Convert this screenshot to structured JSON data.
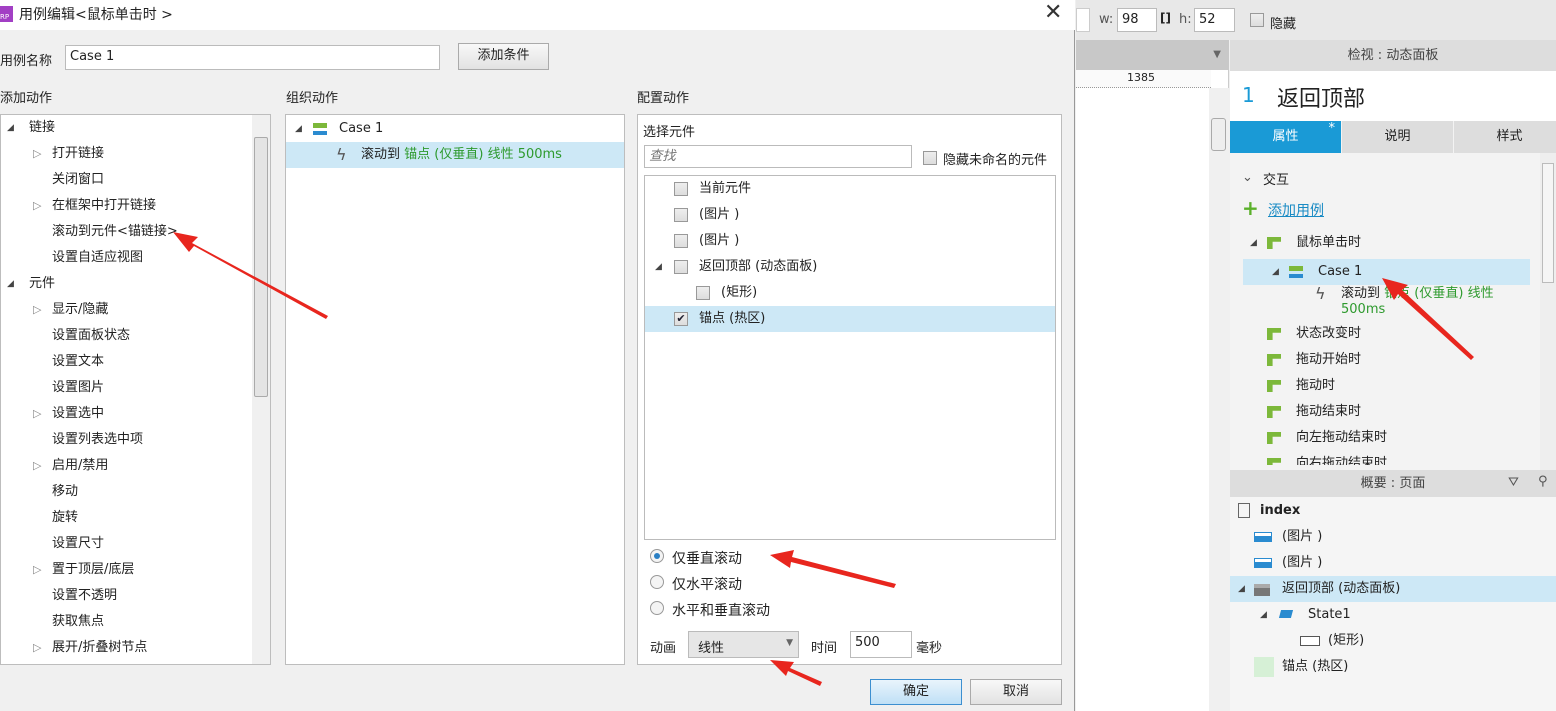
{
  "dialog": {
    "title": "用例编辑<鼠标单击时 >",
    "case_name_label": "用例名称",
    "case_name_value": "Case 1",
    "add_condition": "添加条件",
    "add_action_header": "添加动作",
    "organize_header": "组织动作",
    "configure_header": "配置动作",
    "actions": [
      {
        "label": "链接",
        "level": 0,
        "state": "expanded"
      },
      {
        "label": "打开链接",
        "level": 1,
        "state": "collapsed"
      },
      {
        "label": "关闭窗口",
        "level": 1,
        "state": "none"
      },
      {
        "label": "在框架中打开链接",
        "level": 1,
        "state": "collapsed"
      },
      {
        "label": "滚动到元件<锚链接>",
        "level": 1,
        "state": "none"
      },
      {
        "label": "设置自适应视图",
        "level": 1,
        "state": "none"
      },
      {
        "label": "元件",
        "level": 0,
        "state": "expanded"
      },
      {
        "label": "显示/隐藏",
        "level": 1,
        "state": "collapsed"
      },
      {
        "label": "设置面板状态",
        "level": 1,
        "state": "none"
      },
      {
        "label": "设置文本",
        "level": 1,
        "state": "none"
      },
      {
        "label": "设置图片",
        "level": 1,
        "state": "none"
      },
      {
        "label": "设置选中",
        "level": 1,
        "state": "collapsed"
      },
      {
        "label": "设置列表选中项",
        "level": 1,
        "state": "none"
      },
      {
        "label": "启用/禁用",
        "level": 1,
        "state": "collapsed"
      },
      {
        "label": "移动",
        "level": 1,
        "state": "none"
      },
      {
        "label": "旋转",
        "level": 1,
        "state": "none"
      },
      {
        "label": "设置尺寸",
        "level": 1,
        "state": "none"
      },
      {
        "label": "置于顶层/底层",
        "level": 1,
        "state": "collapsed"
      },
      {
        "label": "设置不透明",
        "level": 1,
        "state": "none"
      },
      {
        "label": "获取焦点",
        "level": 1,
        "state": "none"
      },
      {
        "label": "展开/折叠树节点",
        "level": 1,
        "state": "collapsed"
      }
    ],
    "organize": {
      "case": "Case 1",
      "action_prefix": "滚动到",
      "action_detail": "锚点 (仅垂直) 线性 500ms"
    },
    "configure": {
      "select_widget": "选择元件",
      "search_placeholder": "查找",
      "hide_unnamed": "隐藏未命名的元件",
      "widgets": [
        {
          "label": "当前元件",
          "checked": false,
          "level": 0
        },
        {
          "label": "(图片 )",
          "checked": false,
          "level": 0
        },
        {
          "label": "(图片 )",
          "checked": false,
          "level": 0
        },
        {
          "label": "返回顶部 (动态面板)",
          "checked": false,
          "level": 0,
          "expanded": true
        },
        {
          "label": "(矩形)",
          "checked": false,
          "level": 1
        },
        {
          "label": "锚点 (热区)",
          "checked": true,
          "level": 0,
          "selected": true
        }
      ],
      "scroll_options": [
        {
          "label": "仅垂直滚动",
          "selected": true
        },
        {
          "label": "仅水平滚动",
          "selected": false
        },
        {
          "label": "水平和垂直滚动",
          "selected": false
        }
      ],
      "animate_label": "动画",
      "animate_value": "线性",
      "time_label": "时间",
      "time_value": "500",
      "ms_label": "毫秒"
    },
    "ok": "确定",
    "cancel": "取消"
  },
  "toolbar": {
    "w_label": "w:",
    "w_value": "98",
    "h_label": "h:",
    "h_value": "52",
    "hidden_label": "隐藏"
  },
  "ruler": {
    "mark": "1385"
  },
  "inspector": {
    "title": "检视 : 动态面板",
    "number": "1",
    "name": "返回顶部",
    "tabs": [
      "属性",
      "说明",
      "样式"
    ],
    "tab_mark": "*",
    "interaction": "交互",
    "add_case": "添加用例",
    "event": "鼠标单击时",
    "case": "Case 1",
    "action_prefix": "滚动到",
    "action_detail": "锚点 (仅垂直) 线性",
    "action_time": "500ms",
    "events": [
      "状态改变时",
      "拖动开始时",
      "拖动时",
      "拖动结束时",
      "向左拖动结束时",
      "向右拖动结束时"
    ]
  },
  "outline": {
    "title": "概要 : 页面",
    "page": "index",
    "items": [
      {
        "label": "(图片 )",
        "icon": "image-icon",
        "level": 0
      },
      {
        "label": "(图片 )",
        "icon": "image-icon",
        "level": 0
      },
      {
        "label": "返回顶部 (动态面板)",
        "icon": "dynamic-panel-icon",
        "level": 0,
        "selected": true
      },
      {
        "label": "State1",
        "icon": "state-icon",
        "level": 1
      },
      {
        "label": "(矩形)",
        "icon": "rectangle-icon",
        "level": 2
      },
      {
        "label": "锚点 (热区)",
        "icon": "hotspot-icon",
        "level": 0
      }
    ]
  },
  "colors": {
    "accent": "#1a9ad6",
    "selection": "#cde8f6",
    "green": "#2e9a2e",
    "arrow": "#e8261e"
  }
}
